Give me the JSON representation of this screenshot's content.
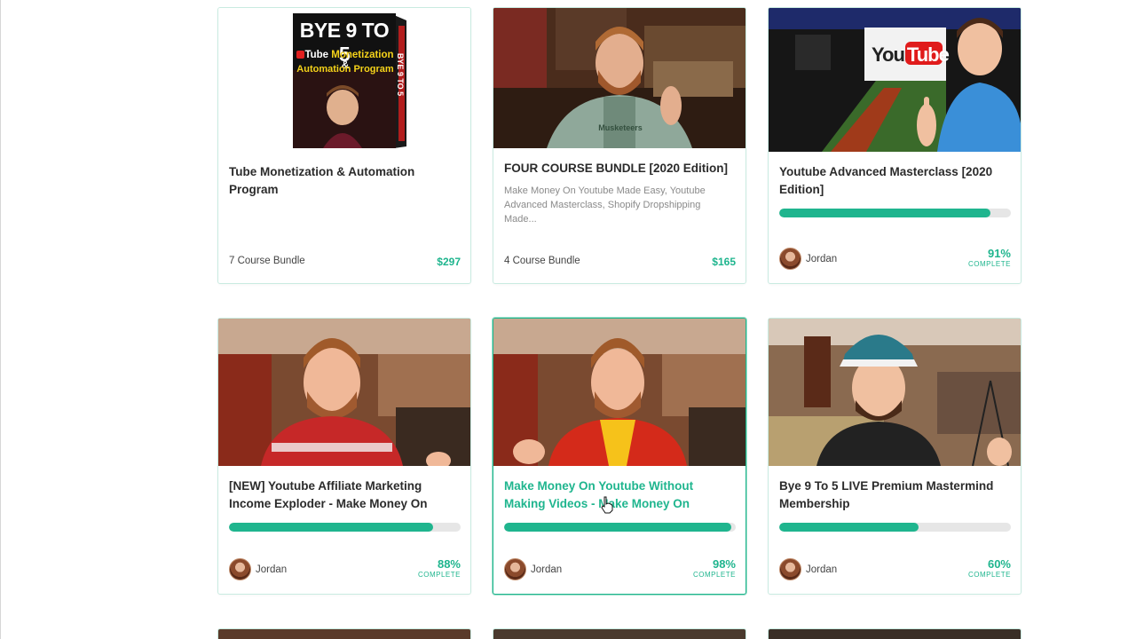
{
  "accent": "#1fb58e",
  "cards": [
    {
      "title": "Tube Monetization & Automation Program",
      "bundle": "7 Course Bundle",
      "price": "$297",
      "box": {
        "line1": "BYE 9 TO 5",
        "line2a": "Tube ",
        "line2b": "Monetization",
        "line2c": " &",
        "line3": "Automation Program",
        "spine": "BYE 9 TO 5"
      }
    },
    {
      "title": "FOUR COURSE BUNDLE [2020 Edition]",
      "description": "Make Money On Youtube Made Easy, Youtube Advanced Masterclass, Shopify Dropshipping Made...",
      "bundle": "4 Course Bundle",
      "price": "$165",
      "shirt_text": "Musketeers"
    },
    {
      "title": "Youtube Advanced Masterclass [2020 Edition]",
      "progress": 91,
      "author": "Jordan",
      "percent": "91%",
      "complete": "COMPLETE",
      "banner": {
        "you": "You",
        "tube": "Tube"
      }
    },
    {
      "title": "[NEW] Youtube Affiliate Marketing Income Exploder - Make Money On",
      "progress": 88,
      "author": "Jordan",
      "percent": "88%",
      "complete": "COMPLETE"
    },
    {
      "title": "Make Money On Youtube Without Making Videos - Make Money On",
      "progress": 98,
      "author": "Jordan",
      "percent": "98%",
      "complete": "COMPLETE"
    },
    {
      "title": "Bye 9 To 5 LIVE Premium Mastermind Membership",
      "progress": 60,
      "author": "Jordan",
      "percent": "60%",
      "complete": "COMPLETE"
    }
  ]
}
